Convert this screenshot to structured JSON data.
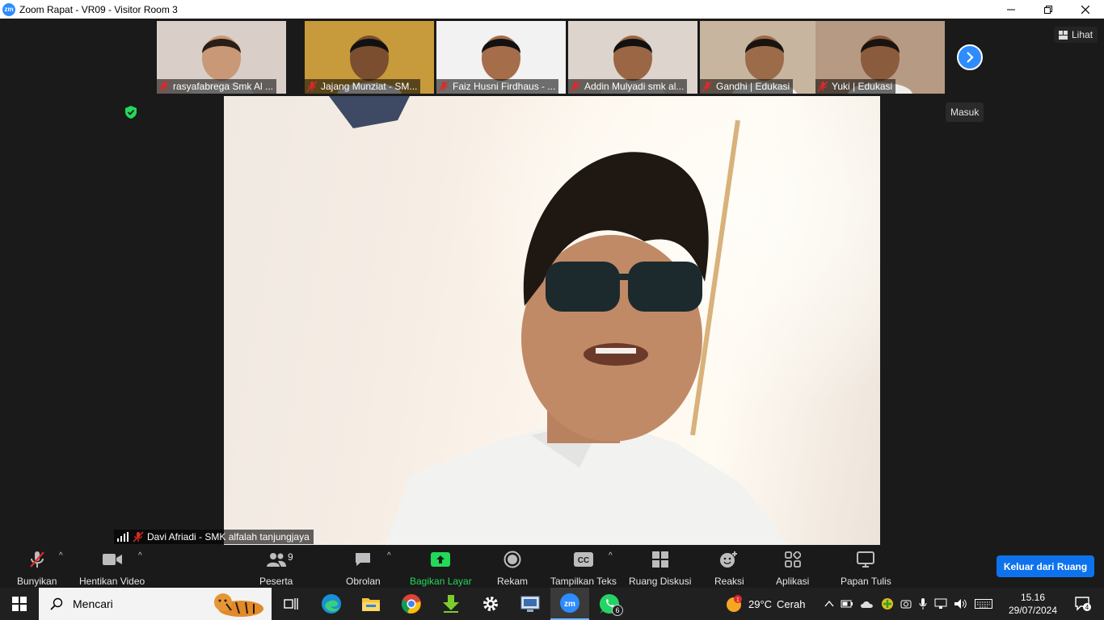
{
  "window": {
    "app_logo": "zm",
    "title": "Zoom Rapat - VR09 - Visitor Room 3",
    "controls": [
      "minimize-icon",
      "restore-icon",
      "close-icon"
    ]
  },
  "participants_strip": [
    {
      "name": "rasyafabrega Smk Al ...",
      "muted": true,
      "bg": "#d9cfc8",
      "skin": "#c89877",
      "hair": "#2b1e16"
    },
    {
      "name": "Jajang Munziat - SM...",
      "muted": true,
      "bg": "#c79a3b",
      "skin": "#7a4e2e",
      "hair": "#111"
    },
    {
      "name": "Faiz Husni Firdhaus - ...",
      "muted": true,
      "bg": "#f2f2f2",
      "skin": "#a66d4a",
      "hair": "#111"
    },
    {
      "name": "Addin Mulyadi smk al...",
      "muted": true,
      "bg": "#ddd5cd",
      "skin": "#9a6644",
      "hair": "#111"
    },
    {
      "name": "Gandhi | Edukasi",
      "muted": true,
      "bg": "#c8b59f",
      "skin": "#9c6b4a",
      "hair": "#1a1410"
    },
    {
      "name": "Yuki | Edukasi",
      "muted": true,
      "bg": "#b79a84",
      "skin": "#8a5b3c",
      "hair": "#1a1410"
    }
  ],
  "view_button": {
    "icon": "grid-icon",
    "label": "Lihat"
  },
  "enter_tooltip": "Masuk",
  "next_page_icon": "chevron-right-icon",
  "security_icon": "shield-check-icon",
  "main_speaker": {
    "name": "Davi Afriadi - SMK alfalah tanjungjaya",
    "muted": true
  },
  "toolbar": {
    "unmute": {
      "label": "Bunyikan",
      "icon": "mic-off-icon"
    },
    "stop_video": {
      "label": "Hentikan Video",
      "icon": "video-camera-icon"
    },
    "participants": {
      "label": "Peserta",
      "icon": "participants-icon",
      "count": "9"
    },
    "chat": {
      "label": "Obrolan",
      "icon": "chat-icon"
    },
    "share": {
      "label": "Bagikan Layar",
      "icon": "share-screen-icon",
      "color": "#23d959"
    },
    "record": {
      "label": "Rekam",
      "icon": "record-icon"
    },
    "captions": {
      "label": "Tampilkan Teks",
      "icon": "cc-icon",
      "icon_text": "CC"
    },
    "breakout": {
      "label": "Ruang Diskusi",
      "icon": "breakout-rooms-icon"
    },
    "reactions": {
      "label": "Reaksi",
      "icon": "emoji-plus-icon"
    },
    "apps": {
      "label": "Aplikasi",
      "icon": "apps-icon"
    },
    "whiteboard": {
      "label": "Papan Tulis",
      "icon": "whiteboard-icon"
    },
    "leave": {
      "label": "Keluar dari Ruang",
      "color": "#0e72ed"
    }
  },
  "taskbar": {
    "search_placeholder": "Mencari",
    "apps": [
      "start-icon",
      "task-view-icon",
      "edge-icon",
      "file-explorer-icon",
      "chrome-icon",
      "download-icon",
      "settings-icon",
      "remote-desktop-icon",
      "zoom-icon",
      "whatsapp-icon"
    ],
    "whatsapp_badge": "6",
    "weather": {
      "badge": "1",
      "temp": "29°C",
      "condition": "Cerah"
    },
    "clock": {
      "time": "15.16",
      "date": "29/07/2024"
    },
    "notifications": "4"
  }
}
